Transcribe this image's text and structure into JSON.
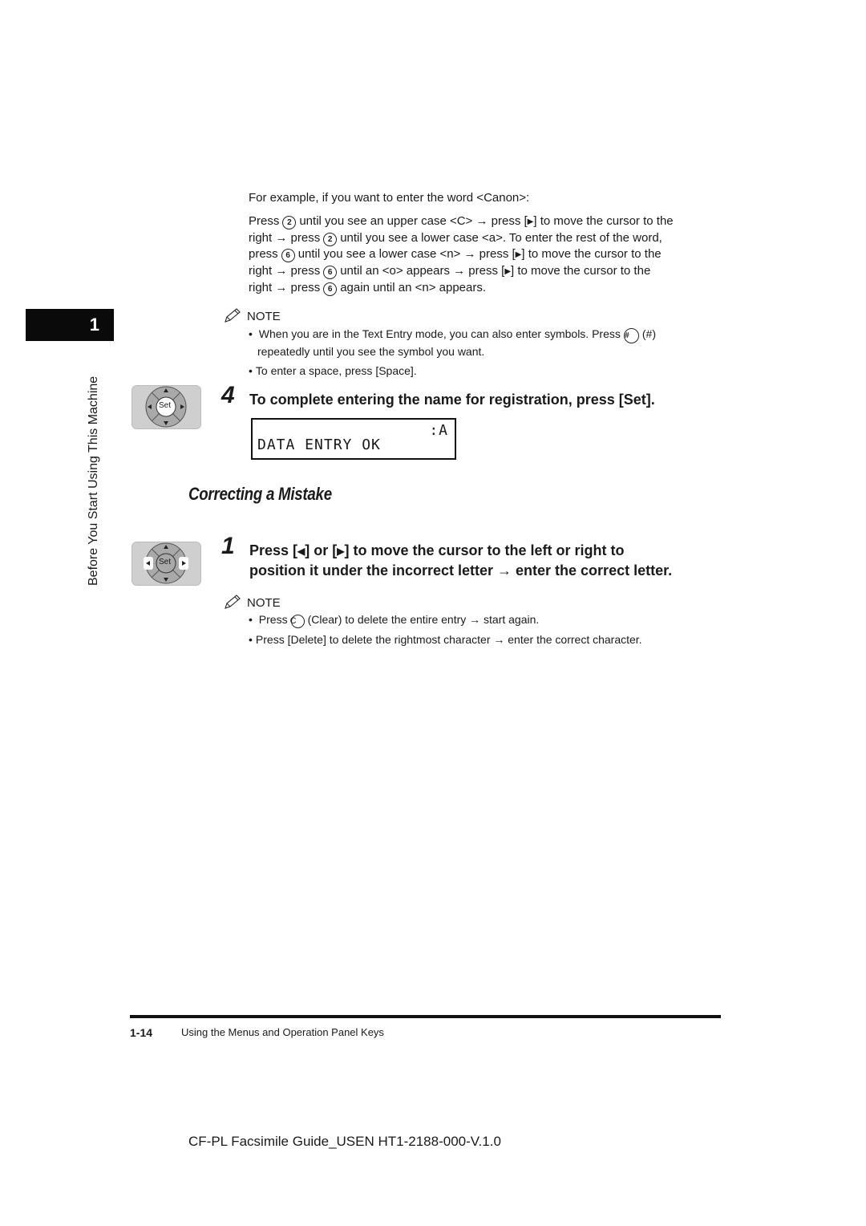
{
  "sidebar": {
    "chapter_number": "1",
    "chapter_title": "Before You Start Using This Machine"
  },
  "intro": {
    "example_line": "For example, if you want to enter the word <Canon>:",
    "paragraph": {
      "l1_a": "Press",
      "l1_key": "2",
      "l1_b": "until you see an upper case <C> → press [",
      "l1_c": "] to move the cursor to the",
      "l2_a": "right → press",
      "l2_key": "2",
      "l2_b": "until you see a lower case <a>. To enter the rest of the word,",
      "l3_a": "press",
      "l3_key": "6",
      "l3_b": "until you see a lower case <n> → press [",
      "l3_c": "] to move the cursor to the",
      "l4_a": "right → press",
      "l4_key": "6",
      "l4_b": "until an <o> appears → press [",
      "l4_c": "] to move the cursor to the",
      "l5_a": "right → press",
      "l5_key": "6",
      "l5_b": "again until an <n> appears."
    }
  },
  "note1": {
    "title": "NOTE",
    "b1_a": "When you are in the Text Entry mode, you can also enter symbols. Press",
    "b1_key": "#",
    "b1_b": "(#)",
    "b1_c": "repeatedly until you see the symbol you want.",
    "b2": "To enter a space, press [Space]."
  },
  "step4": {
    "number": "4",
    "text": "To complete entering the name for registration, press [Set].",
    "keypad_center_label": "Set",
    "lcd": {
      "line1": ":A",
      "line2": "DATA ENTRY OK"
    }
  },
  "section": {
    "title": "Correcting a Mistake"
  },
  "step1": {
    "number": "1",
    "text_a": "Press [",
    "text_b": "] or [",
    "text_c": "] to move the cursor to the left or right to",
    "text_d": "position it under the incorrect letter → enter the correct letter.",
    "keypad_center_label": "Set"
  },
  "note2": {
    "title": "NOTE",
    "b1_a": "Press",
    "b1_key": "C",
    "b1_b": "(Clear) to delete the entire entry → start again.",
    "b2": "Press [Delete] to delete the rightmost character → enter the correct character."
  },
  "footer": {
    "page_number": "1-14",
    "section_name": "Using the Menus and Operation Panel Keys",
    "doc_id": "CF-PL Facsimile Guide_USEN HT1-2188-000-V.1.0"
  },
  "icons": {
    "right_arrow": "right-triangle-icon",
    "left_arrow": "left-triangle-icon",
    "note": "pencil-icon",
    "keypad": "set-keypad-icon"
  }
}
